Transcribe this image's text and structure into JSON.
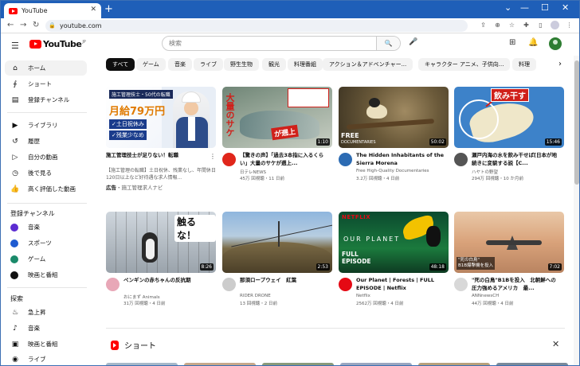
{
  "browser": {
    "tab_title": "YouTube",
    "new_tab": "+",
    "url": "youtube.com",
    "window_controls": [
      "⌄",
      "—",
      "☐",
      "✕"
    ]
  },
  "masthead": {
    "logo_text": "YouTube",
    "logo_region": "JP",
    "search_placeholder": "検索",
    "search_button": "🔍",
    "mic": "🎤"
  },
  "sidebar": {
    "primary": [
      {
        "label": "ホーム",
        "icon": "home-icon",
        "glyph": "⌂",
        "active": true
      },
      {
        "label": "ショート",
        "icon": "shorts-icon",
        "glyph": "∮"
      },
      {
        "label": "登録チャンネル",
        "icon": "subscriptions-icon",
        "glyph": "▤"
      }
    ],
    "library": [
      {
        "label": "ライブラリ",
        "icon": "library-icon",
        "glyph": "▶"
      },
      {
        "label": "履歴",
        "icon": "history-icon",
        "glyph": "↺"
      },
      {
        "label": "自分の動画",
        "icon": "your-videos-icon",
        "glyph": "▷"
      },
      {
        "label": "後で見る",
        "icon": "watch-later-icon",
        "glyph": "◷"
      },
      {
        "label": "高く評価した動画",
        "icon": "liked-icon",
        "glyph": "👍"
      }
    ],
    "subscriptions_heading": "登録チャンネル",
    "subscriptions": [
      {
        "label": "音楽",
        "color": "#5b2bd1"
      },
      {
        "label": "スポーツ",
        "color": "#1e5bd1"
      },
      {
        "label": "ゲーム",
        "color": "#1a8a6a"
      },
      {
        "label": "映画と番組",
        "color": "#111111"
      }
    ],
    "explore_heading": "探索",
    "explore": [
      {
        "label": "急上昇",
        "icon": "trending-icon",
        "glyph": "♨"
      },
      {
        "label": "音楽",
        "icon": "music-icon",
        "glyph": "♪"
      },
      {
        "label": "映画と番組",
        "icon": "movies-icon",
        "glyph": "▣"
      },
      {
        "label": "ライブ",
        "icon": "live-icon",
        "glyph": "◉"
      }
    ]
  },
  "chips": [
    "すべて",
    "ゲーム",
    "音楽",
    "ライブ",
    "野生生物",
    "観光",
    "料理番組",
    "アクション＆アドベンチャー...",
    "キャラクター アニメ、子供向...",
    "料理"
  ],
  "ad": {
    "title": "施工管理技士が足りない！転職",
    "description": "【施工管理の転職】土日祝休、残業なし、年間休日120日以上など好待遇な求人情報...",
    "label_bold": "広告",
    "advertiser": "・施工管理求人ナビ",
    "thumb": {
      "header": "施工管理技士・50代の転職",
      "big": "月給79万円",
      "line1": "✓土日祝休み",
      "line2": "✓残業少なめ"
    }
  },
  "videos_row1": [
    {
      "title": "【驚きの声】「過去3本指に入るくらい」大量のサケが遡上...",
      "channel": "日テレNEWS",
      "meta": "45万 回視聴・11 日前",
      "duration": "1:10",
      "avatar_color": "#e0261b",
      "thumb": {
        "text1": "大量のサケ",
        "text2": "が遡上"
      }
    },
    {
      "title": "The Hidden Inhabitants of the Sierra Morena",
      "channel": "Free High-Quality Documentaries",
      "meta": "3.2万 回視聴・4 日前",
      "duration": "50:02",
      "avatar_color": "#2c6bb3",
      "thumb": {
        "line1": "FREE",
        "line2": "DOCUMENTARIES"
      }
    },
    {
      "title": "瀬戸内海の水を飲み干せば[日本が地続きに変貌する説【C...",
      "channel": "ハヤトの野望",
      "meta": "294万 回視聴・10 か月前",
      "duration": "15:46",
      "avatar_color": "#555555",
      "thumb": {
        "text": "飲み干す"
      }
    }
  ],
  "videos_row2": [
    {
      "title": "ペンギンの赤ちゃんの反抗期",
      "channel": "おにまず Animals",
      "meta": "31万 回視聴・4 日前",
      "duration": "8:26",
      "avatar_color": "#e8a7b7",
      "thumb": {
        "text": "触るな！"
      }
    },
    {
      "title": "那須ロープウェイ　紅葉",
      "channel": "RIDER DRONE",
      "meta": "13 回視聴・2 日前",
      "duration": "2:53",
      "avatar_color": "#cccccc"
    },
    {
      "title": "Our Planet | Forests | FULL EPISODE | Netflix",
      "channel": "Netflix",
      "meta": "2562万 回視聴・4 日前",
      "duration": "48:18",
      "avatar_color": "#e50914",
      "thumb": {
        "brand": "NETFLIX",
        "name": "OUR PLANET",
        "full1": "FULL",
        "full2": "EPISODE"
      }
    },
    {
      "title": "\"死の白鳥\"B1Bを投入　北朝鮮への圧力強めるアメリカ　最...",
      "channel": "ANNnewsCH",
      "meta": "44万 回視聴・4 日前",
      "duration": "7:02",
      "avatar_color": "#d8d8d8",
      "thumb": {
        "caption1": "\"死の白鳥\"",
        "caption2": "B1B爆撃機を投入"
      }
    }
  ],
  "shorts_title": "ショート",
  "shorts_close": "✕",
  "kebab": "⋮",
  "chip_next": "›"
}
